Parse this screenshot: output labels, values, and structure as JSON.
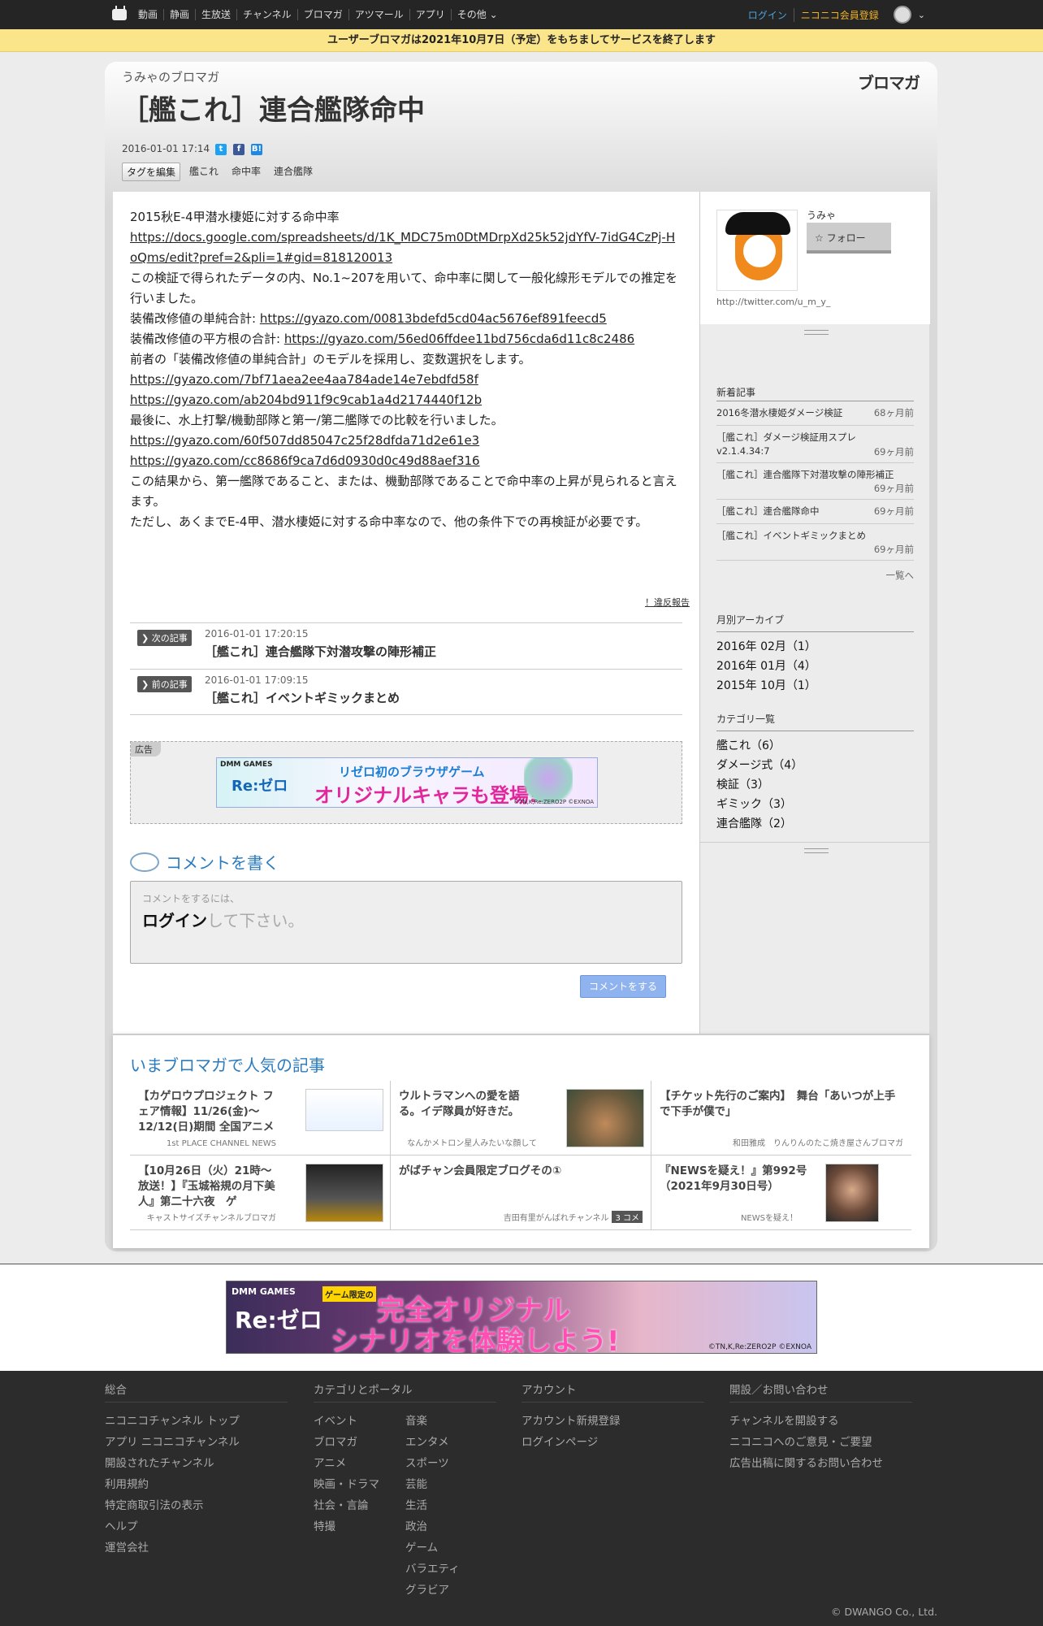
{
  "topbar": {
    "nav": [
      "動画",
      "静画",
      "生放送",
      "チャンネル",
      "ブロマガ",
      "アツマール",
      "アプリ",
      "その他"
    ],
    "login": "ログイン",
    "register": "ニコニコ会員登録"
  },
  "notice": "ユーザーブロマガは2021年10月7日（予定）をもちましてサービスを終了します",
  "blog": {
    "name": "うみゃのブロマガ",
    "logo": "ブロマガ",
    "title": "［艦これ］連合艦隊命中",
    "date": "2016-01-01 17:14",
    "tag_edit": "タグを編集",
    "tags": [
      "艦これ",
      "命中率",
      "連合艦隊"
    ]
  },
  "article": {
    "lines": [
      {
        "text": "2015秋E-4甲潜水棲姫に対する命中率",
        "link": ""
      },
      {
        "text": "",
        "link": "https://docs.google.com/spreadsheets/d/1K_MDC75m0DtMDrpXd25k52jdYfV-7idG4CzPj-HoQms/edit?pref=2&pli=1#gid=818120013"
      },
      {
        "text": "この検証で得られたデータの内、No.1~207を用いて、命中率に関して一般化線形モデルでの推定を行いました。",
        "link": ""
      },
      {
        "text": "装備改修値の単純合計: ",
        "link": "https://gyazo.com/00813bdefd5cd04ac5676ef891feecd5"
      },
      {
        "text": "装備改修値の平方根の合計: ",
        "link": "https://gyazo.com/56ed06ffdee11bd756cda6d11c8c2486"
      },
      {
        "text": "前者の「装備改修値の単純合計」のモデルを採用し、変数選択をします。",
        "link": ""
      },
      {
        "text": "",
        "link": "https://gyazo.com/7bf71aea2ee4aa784ade14e7ebdfd58f"
      },
      {
        "text": "",
        "link": "https://gyazo.com/ab204bd911f9c9cab1a4d2174440f12b"
      },
      {
        "text": "最後に、水上打撃/機動部隊と第一/第二艦隊での比較を行いました。",
        "link": ""
      },
      {
        "text": "",
        "link": "https://gyazo.com/60f507dd85047c25f28dfda71d2e61e3"
      },
      {
        "text": "",
        "link": "https://gyazo.com/cc8686f9ca7d6d0930d0c49d88aef316"
      },
      {
        "text": "この結果から、第一艦隊であること、または、機動部隊であることで命中率の上昇が見られると言えます。",
        "link": ""
      },
      {
        "text": "ただし、あくまでE-4甲、潜水棲姫に対する命中率なので、他の条件下での再検証が必要です。",
        "link": ""
      }
    ],
    "report": "！違反報告",
    "next": {
      "label": "次の記事",
      "date": "2016-01-01 17:20:15",
      "title": "［艦これ］連合艦隊下対潜攻撃の陣形補正"
    },
    "prev": {
      "label": "前の記事",
      "date": "2016-01-01 17:09:15",
      "title": "［艦これ］イベントギミックまとめ"
    }
  },
  "ad": {
    "label": "広告",
    "brand": "DMM GAMES",
    "re": "Re:ゼロ",
    "line1": "リゼロ初のブラウザゲーム",
    "line2": "オリジナルキャラも登場!!",
    "copy": "©TN,K,Re:ZERO2P ©EXNOA"
  },
  "comment": {
    "heading": "コメントを書く",
    "placeholder_small": "コメントをするには、",
    "placeholder_login": "ログイン",
    "placeholder_rest": "して下さい。",
    "button": "コメントをする"
  },
  "sidebar": {
    "user": "うみゃ",
    "follow": "☆ フォロー",
    "url": "http://twitter.com/u_m_y_",
    "recent_title": "新着記事",
    "recent": [
      {
        "title": "2016冬潜水棲姫ダメージ検証",
        "ago": "68ヶ月前"
      },
      {
        "title": "［艦これ］ダメージ検証用スプレv2.1.4.34:7",
        "ago": "69ヶ月前"
      },
      {
        "title": "［艦これ］連合艦隊下対潜攻撃の陣形補正",
        "ago": "69ヶ月前"
      },
      {
        "title": "［艦これ］連合艦隊命中",
        "ago": "69ヶ月前"
      },
      {
        "title": "［艦これ］イベントギミックまとめ",
        "ago": "69ヶ月前"
      }
    ],
    "more": "一覧へ",
    "archive_title": "月別アーカイブ",
    "archive": [
      "2016年 02月（1）",
      "2016年 01月（4）",
      "2015年 10月（1）"
    ],
    "category_title": "カテゴリ一覧",
    "categories": [
      "艦これ（6）",
      "ダメージ式（4）",
      "検証（3）",
      "ギミック（3）",
      "連合艦隊（2）"
    ]
  },
  "popular": {
    "heading": "いまブロマガで人気の記事",
    "items": [
      {
        "title": "【カゲロウプロジェクト フェア情報】11/26(金)～12/12(日)期間 全国アニメ",
        "source": "1st PLACE CHANNEL NEWS"
      },
      {
        "title": "ウルトラマンへの愛を語る。イデ隊員が好きだ。",
        "source": "なんかメトロン星人みたいな顔して"
      },
      {
        "title": "【チケット先行のご案内】　舞台「あいつが上手で下手が僕で」",
        "source": "和田雅成　りんりんのたこ焼き屋さんブロマガ"
      },
      {
        "title": "【10月26日（火）21時～放送！】『玉城裕規の月下美人』第二十六夜　ゲ",
        "source": "キャストサイズチャンネルブロマガ"
      },
      {
        "title": "がばチャン会員限定ブログその①",
        "source": "吉田有里がんばれチャンネル",
        "badge": "3 コメ"
      },
      {
        "title": "『NEWSを疑え！』第992号（2021年9月30日号）",
        "source": "NEWSを疑え！"
      }
    ]
  },
  "banner": {
    "brand": "DMM GAMES",
    "re": "Re:ゼロ",
    "tag": "ゲーム限定の",
    "line1": "完全オリジナル",
    "line2": "シナリオを体験しよう!",
    "copy": "©TN,K,Re:ZERO2P ©EXNOA"
  },
  "footer": {
    "col1": {
      "title": "総合",
      "items": [
        "ニコニコチャンネル トップ",
        "アプリ ニコニコチャンネル",
        "開設されたチャンネル",
        "利用規約",
        "特定商取引法の表示",
        "ヘルプ",
        "運営会社"
      ]
    },
    "col2": {
      "title": "カテゴリとポータル",
      "left": [
        "イベント",
        "ブロマガ",
        "アニメ",
        "映画・ドラマ",
        "社会・言論",
        "特撮"
      ],
      "right": [
        "音楽",
        "エンタメ",
        "スポーツ",
        "芸能",
        "生活",
        "政治",
        "ゲーム",
        "バラエティ",
        "グラビア"
      ]
    },
    "col3": {
      "title": "アカウント",
      "items": [
        "アカウント新規登録",
        "ログインページ"
      ]
    },
    "col4": {
      "title": "開設／お問い合わせ",
      "items": [
        "チャンネルを開設する",
        "ニコニコへのご意見・ご要望",
        "広告出稿に関するお問い合わせ"
      ]
    },
    "copyright": "© DWANGO Co., Ltd."
  }
}
